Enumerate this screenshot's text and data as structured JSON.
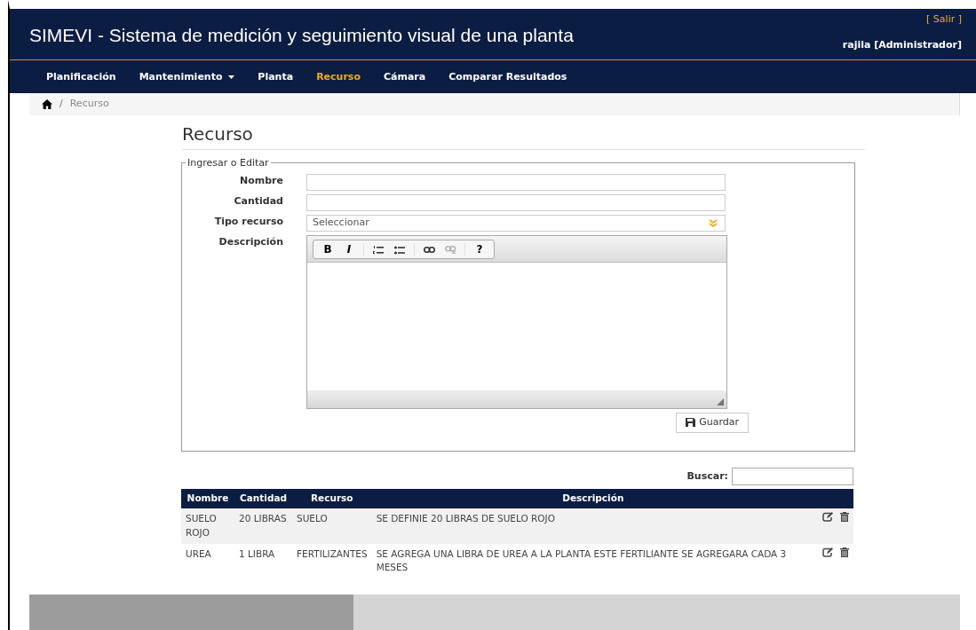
{
  "header": {
    "title": "SIMEVI - Sistema de medición y seguimiento visual de una planta",
    "logout": "[ Salir ]",
    "user": "rajila [Administrador]"
  },
  "nav": [
    {
      "label": "Planificación",
      "selected": false,
      "dropdown": false
    },
    {
      "label": "Mantenimiento",
      "selected": false,
      "dropdown": true
    },
    {
      "label": "Planta",
      "selected": false,
      "dropdown": false
    },
    {
      "label": "Recurso",
      "selected": true,
      "dropdown": false
    },
    {
      "label": "Cámara",
      "selected": false,
      "dropdown": false
    },
    {
      "label": "Comparar Resultados",
      "selected": false,
      "dropdown": false
    }
  ],
  "breadcrumb": {
    "separator": "/",
    "items": [
      "Recurso"
    ]
  },
  "page_title": "Recurso",
  "form": {
    "legend": "Ingresar o Editar",
    "fields": [
      {
        "label": "Nombre",
        "kind": "text"
      },
      {
        "label": "Cantidad",
        "kind": "text"
      },
      {
        "label": "Tipo recurso",
        "kind": "select",
        "value": "Seleccionar"
      },
      {
        "label": "Descripción",
        "kind": "editor"
      }
    ],
    "toolbar": [
      {
        "kind": "bold",
        "label": "B",
        "disabled": false
      },
      {
        "kind": "italic",
        "label": "I",
        "disabled": false
      },
      {
        "kind": "ordered-list",
        "disabled": false
      },
      {
        "kind": "bullet-list",
        "disabled": false
      },
      {
        "kind": "link",
        "disabled": false
      },
      {
        "kind": "unlink",
        "disabled": true
      },
      {
        "kind": "help",
        "label": "?",
        "disabled": false
      }
    ],
    "save": "Guardar"
  },
  "search": {
    "label": "Buscar:"
  },
  "table": {
    "columns": [
      "Nombre",
      "Cantidad",
      "Recurso",
      "Descripción"
    ],
    "rows": [
      {
        "cells": [
          "SUELO ROJO",
          "20 LIBRAS",
          "SUELO",
          "SE DEFINIE 20 LIBRAS DE SUELO ROJO"
        ]
      },
      {
        "cells": [
          "UREA",
          "1 LIBRA",
          "FERTILIZANTES",
          "SE AGREGA UNA LIBRA DE UREA A LA PLANTA ESTE FERTILIANTE SE AGREGARA CADA 3 MESES"
        ]
      }
    ]
  }
}
